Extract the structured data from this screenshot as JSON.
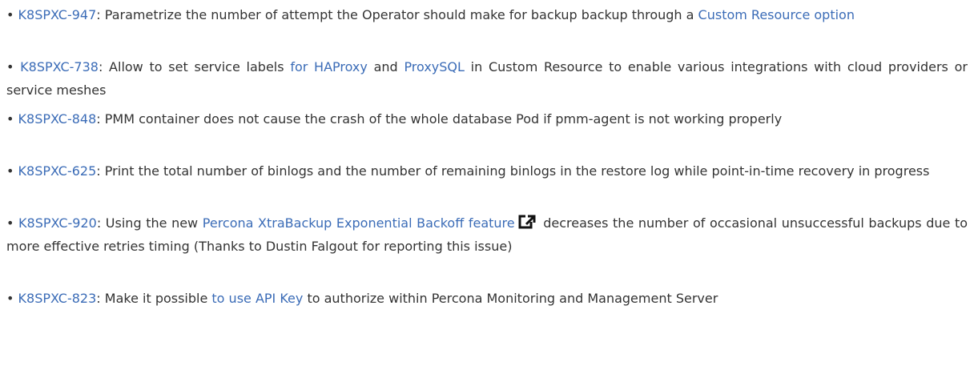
{
  "items": [
    {
      "id_link": "K8SPXC-947",
      "t1": ": Parametrize the number of attempt the Operator should make for backup backup through a ",
      "link2": "Custom Resource option",
      "t2": ""
    },
    {
      "id_link": "K8SPXC-738",
      "t1": ": Allow to set service labels ",
      "link2": "for HAProxy",
      "t2": " and ",
      "link3": "ProxySQL",
      "t3": " in Custom Resource to enable various integrations with cloud providers or service meshes"
    },
    {
      "id_link": "K8SPXC-848",
      "t1": ": PMM container does not cause the crash of the whole database Pod if pmm-agent is not working properly"
    },
    {
      "id_link": "K8SPXC-625",
      "t1": ": Print the total number of binlogs and the number of remaining binlogs in the restore log while point-in-time recovery in progress"
    },
    {
      "id_link": "K8SPXC-920",
      "t1": ": Using the new ",
      "link2": "Percona XtraBackup Exponential Backoff feature",
      "icon": "external-link-icon",
      "t2": " decreases the number of occasional unsuccessful backups due to more effective retries timing (Thanks to Dustin Falgout for reporting this issue)"
    },
    {
      "id_link": "K8SPXC-823",
      "t1": ": Make it possible ",
      "link2": "to use API Key",
      "t2": " to authorize within Percona Monitoring and Management Server"
    }
  ],
  "colors": {
    "link": "#3b6cb7",
    "text": "#333333"
  }
}
